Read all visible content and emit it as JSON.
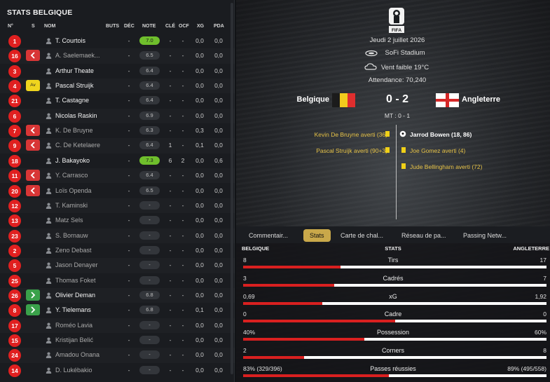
{
  "left_panel": {
    "title": "STATS BELGIQUE",
    "columns": [
      "N°",
      "S",
      "NOM",
      "BUTS",
      "DÉC",
      "NOTE",
      "CLÉ",
      "OCF",
      "XG",
      "PDA"
    ],
    "players": [
      {
        "num": "1",
        "sub": "",
        "name": "T. Courtois",
        "buts": "",
        "dec": "-",
        "note": "7.0",
        "note_good": true,
        "cle": "-",
        "ocf": "-",
        "xg": "0,0",
        "pda": "0,0",
        "starter": true
      },
      {
        "num": "16",
        "sub": "out",
        "name": "A. Saelemaek...",
        "buts": "",
        "dec": "-",
        "note": "6.5",
        "note_good": false,
        "cle": "-",
        "ocf": "-",
        "xg": "0,0",
        "pda": "0,0",
        "starter": false
      },
      {
        "num": "3",
        "sub": "",
        "name": "Arthur Theate",
        "buts": "",
        "dec": "-",
        "note": "6.4",
        "note_good": false,
        "cle": "-",
        "ocf": "-",
        "xg": "0,0",
        "pda": "0,0",
        "starter": true
      },
      {
        "num": "4",
        "sub": "av",
        "sub_label": "Av",
        "name": "Pascal Struijk",
        "buts": "",
        "dec": "-",
        "note": "6.4",
        "note_good": false,
        "cle": "-",
        "ocf": "-",
        "xg": "0,0",
        "pda": "0,0",
        "starter": true
      },
      {
        "num": "21",
        "sub": "",
        "name": "T. Castagne",
        "buts": "",
        "dec": "-",
        "note": "6.4",
        "note_good": false,
        "cle": "-",
        "ocf": "-",
        "xg": "0,0",
        "pda": "0,0",
        "starter": true
      },
      {
        "num": "6",
        "sub": "",
        "name": "Nicolas Raskin",
        "buts": "",
        "dec": "-",
        "note": "6.9",
        "note_good": false,
        "cle": "-",
        "ocf": "-",
        "xg": "0,0",
        "pda": "0,0",
        "starter": true
      },
      {
        "num": "7",
        "sub": "out",
        "name": "K. De Bruyne",
        "buts": "",
        "dec": "-",
        "note": "6.3",
        "note_good": false,
        "cle": "-",
        "ocf": "-",
        "xg": "0,3",
        "pda": "0,0",
        "starter": false
      },
      {
        "num": "9",
        "sub": "out",
        "name": "C. De Ketelaere",
        "buts": "",
        "dec": "-",
        "note": "6.4",
        "note_good": false,
        "cle": "1",
        "ocf": "-",
        "xg": "0,1",
        "pda": "0,0",
        "starter": false
      },
      {
        "num": "18",
        "sub": "",
        "name": "J. Bakayoko",
        "buts": "",
        "dec": "-",
        "note": "7.3",
        "note_good": true,
        "cle": "6",
        "ocf": "2",
        "xg": "0,0",
        "pda": "0,6",
        "starter": true
      },
      {
        "num": "11",
        "sub": "out",
        "name": "Y. Carrasco",
        "buts": "",
        "dec": "-",
        "note": "6.4",
        "note_good": false,
        "cle": "-",
        "ocf": "-",
        "xg": "0,0",
        "pda": "0,0",
        "starter": false
      },
      {
        "num": "20",
        "sub": "out",
        "name": "Loïs Openda",
        "buts": "",
        "dec": "-",
        "note": "6.5",
        "note_good": false,
        "cle": "-",
        "ocf": "-",
        "xg": "0,0",
        "pda": "0,0",
        "starter": false
      },
      {
        "num": "12",
        "sub": "",
        "name": "T. Kaminski",
        "buts": "",
        "dec": "-",
        "note": "-",
        "note_good": false,
        "cle": "-",
        "ocf": "-",
        "xg": "0,0",
        "pda": "0,0",
        "starter": false
      },
      {
        "num": "13",
        "sub": "",
        "name": "Matz Sels",
        "buts": "",
        "dec": "-",
        "note": "-",
        "note_good": false,
        "cle": "-",
        "ocf": "-",
        "xg": "0,0",
        "pda": "0,0",
        "starter": false
      },
      {
        "num": "23",
        "sub": "",
        "name": "S. Bornauw",
        "buts": "",
        "dec": "-",
        "note": "-",
        "note_good": false,
        "cle": "-",
        "ocf": "-",
        "xg": "0,0",
        "pda": "0,0",
        "starter": false
      },
      {
        "num": "2",
        "sub": "",
        "name": "Zeno Debast",
        "buts": "",
        "dec": "-",
        "note": "-",
        "note_good": false,
        "cle": "-",
        "ocf": "-",
        "xg": "0,0",
        "pda": "0,0",
        "starter": false
      },
      {
        "num": "5",
        "sub": "",
        "name": "Jason Denayer",
        "buts": "",
        "dec": "-",
        "note": "-",
        "note_good": false,
        "cle": "-",
        "ocf": "-",
        "xg": "0,0",
        "pda": "0,0",
        "starter": false
      },
      {
        "num": "25",
        "sub": "",
        "name": "Thomas Foket",
        "buts": "",
        "dec": "-",
        "note": "-",
        "note_good": false,
        "cle": "-",
        "ocf": "-",
        "xg": "0,0",
        "pda": "0,0",
        "starter": false
      },
      {
        "num": "26",
        "sub": "in",
        "name": "Olivier Deman",
        "buts": "",
        "dec": "-",
        "note": "6.8",
        "note_good": false,
        "cle": "-",
        "ocf": "-",
        "xg": "0,0",
        "pda": "0,0",
        "starter": true
      },
      {
        "num": "8",
        "sub": "in",
        "name": "Y. Tielemans",
        "buts": "",
        "dec": "-",
        "note": "6.8",
        "note_good": false,
        "cle": "-",
        "ocf": "-",
        "xg": "0,1",
        "pda": "0,0",
        "starter": true
      },
      {
        "num": "17",
        "sub": "",
        "name": "Roméo Lavia",
        "buts": "",
        "dec": "-",
        "note": "-",
        "note_good": false,
        "cle": "-",
        "ocf": "-",
        "xg": "0,0",
        "pda": "0,0",
        "starter": false
      },
      {
        "num": "15",
        "sub": "",
        "name": "Kristijan Belić",
        "buts": "",
        "dec": "-",
        "note": "-",
        "note_good": false,
        "cle": "-",
        "ocf": "-",
        "xg": "0,0",
        "pda": "0,0",
        "starter": false
      },
      {
        "num": "24",
        "sub": "",
        "name": "Amadou Onana",
        "buts": "",
        "dec": "-",
        "note": "-",
        "note_good": false,
        "cle": "-",
        "ocf": "-",
        "xg": "0,0",
        "pda": "0,0",
        "starter": false
      },
      {
        "num": "14",
        "sub": "",
        "name": "D. Lukébakio",
        "buts": "",
        "dec": "-",
        "note": "-",
        "note_good": false,
        "cle": "-",
        "ocf": "-",
        "xg": "0,0",
        "pda": "0,0",
        "starter": false
      }
    ]
  },
  "match": {
    "competition_logo": "fifa-world-cup-logo",
    "competition_logo_text": "FIFA",
    "date": "Jeudi 2 juillet 2026",
    "stadium": "SoFi Stadium",
    "weather": "Vent faible 19°C",
    "attendance": "Attendance: 70,240",
    "home_team": "Belgique",
    "away_team": "Angleterre",
    "score": "0 - 2",
    "halftime": "MT : 0 - 1",
    "home_events": [
      "Kevin De Bruyne averti (36)",
      "Pascal Struijk averti (90+3)"
    ],
    "away_events": [
      {
        "text": "Jarrod Bowen (18, 86)",
        "type": "goal"
      },
      {
        "text": "Joe Gomez averti (4)",
        "type": "card"
      },
      {
        "text": "Jude Bellingham averti (72)",
        "type": "card"
      }
    ]
  },
  "tabs": [
    "Commentair...",
    "Stats",
    "Carte de chal...",
    "Réseau de pa...",
    "Passing Netw..."
  ],
  "active_tab": "Stats",
  "stats": {
    "home_label": "BELGIQUE",
    "title": "STATS",
    "away_label": "ANGLETERRE",
    "rows": [
      {
        "label": "Tirs",
        "home": "8",
        "away": "17",
        "home_share": 0.32
      },
      {
        "label": "Cadrés",
        "home": "3",
        "away": "7",
        "home_share": 0.3
      },
      {
        "label": "xG",
        "home": "0,69",
        "away": "1,92",
        "home_share": 0.26
      },
      {
        "label": "Cadre",
        "home": "0",
        "away": "0",
        "home_share": 0.5
      },
      {
        "label": "Possession",
        "home": "40%",
        "away": "60%",
        "home_share": 0.4
      },
      {
        "label": "Corners",
        "home": "2",
        "away": "8",
        "home_share": 0.2
      },
      {
        "label": "Passes réussies",
        "home": "83% (329/396)",
        "away": "89% (495/558)",
        "home_share": 0.48
      }
    ]
  },
  "colors": {
    "accent": "#c9a84a",
    "number_badge": "#e02020",
    "sub_out": "#d83636",
    "sub_in": "#3aa14a",
    "good_note": "#6fbf2c",
    "stat_bar_home": "#d92020",
    "card_yellow": "#f0d018"
  }
}
